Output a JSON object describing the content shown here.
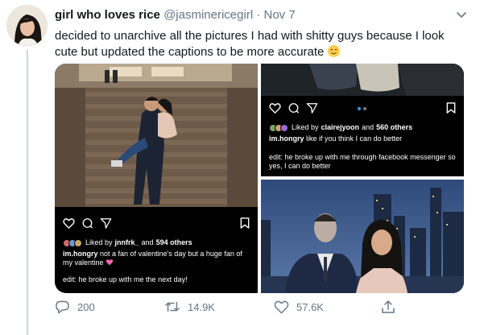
{
  "tweet": {
    "display_name": "girl who loves rice",
    "handle": "@jasminericegirl",
    "separator": "·",
    "date": "Nov 7",
    "text": "decided to unarchive all the pictures I had with shitty guys because I look cute but updated the captions to be more accurate",
    "emoji": "relieved-face"
  },
  "media": {
    "post1": {
      "liked_prefix": "Liked by",
      "liked_user": "jnnfrk_",
      "liked_and": "and",
      "liked_count": "594 others",
      "caption_user": "im.hongry",
      "caption": "not a fan of valentine's day but a huge fan of my valentine",
      "edit": "edit: he broke up with me the next day!"
    },
    "post2": {
      "liked_prefix": "Liked by",
      "liked_user": "clairejyoon",
      "liked_and": "and",
      "liked_count": "560 others",
      "caption_user": "im.hongry",
      "caption": "like if you think I can do better",
      "edit": "edit: he broke up with me through facebook messenger so yes, I can do better"
    }
  },
  "actions": {
    "replies": "200",
    "retweets": "14.9K",
    "likes": "57.6K"
  },
  "colors": {
    "muted": "#657786",
    "thread_line": "#ccd6dd",
    "heart_emoji": "#ff69b4"
  }
}
